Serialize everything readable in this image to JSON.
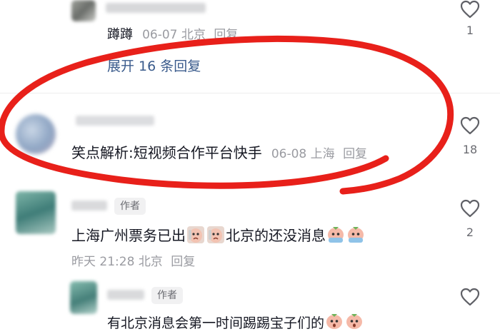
{
  "comments": [
    {
      "username_hidden": true,
      "content": "蹲蹲",
      "date": "06-07",
      "location": "北京",
      "reply_label": "回复",
      "likes": "1",
      "expand_label": "展开 16 条回复"
    },
    {
      "username_hidden": true,
      "content": "笑点解析:短视频合作平台快手",
      "date": "06-08",
      "location": "上海",
      "reply_label": "回复",
      "likes": "18"
    },
    {
      "username_hidden": true,
      "author_tag": "作者",
      "content_a": "上海广州票务已出",
      "content_b": "北京的还没消息",
      "date": "昨天 21:28",
      "location": "北京",
      "reply_label": "回复",
      "likes": "2"
    },
    {
      "username_hidden": true,
      "author_tag": "作者",
      "content": "有北京消息会第一时间踢踢宝子们的",
      "likes": ""
    }
  ],
  "colors": {
    "annotation_circle": "#e8201a",
    "meta_text": "#9a9ba1",
    "expand_link": "#3a5b8c"
  },
  "icons": [
    "heart-icon",
    "crying-emoji-icon",
    "surprised-emoji-icon"
  ]
}
